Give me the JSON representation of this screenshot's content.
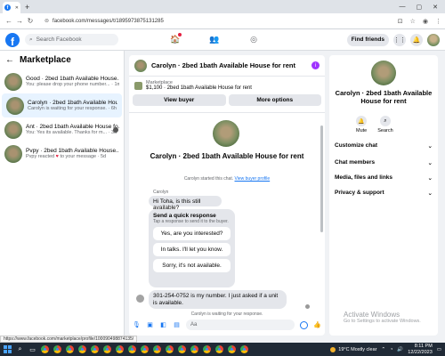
{
  "browser": {
    "tab_favicon": "f",
    "url": "facebook.com/messages/t/1895973875131285",
    "status_url": "https://www.facebook.com/marketplace/profile/100090498874135/"
  },
  "fb": {
    "logo": "f",
    "search_placeholder": "Search Facebook",
    "find_friends": "Find friends"
  },
  "left": {
    "title": "Marketplace",
    "conversations": [
      {
        "name": "Good · 2bed 1bath Available House...",
        "sub": "You: please drop your phone number... · 1m"
      },
      {
        "name": "Carolyn · 2bed 1bath Available House...",
        "sub": "Carolyn is waiting for your response. · 6h"
      },
      {
        "name": "Ant · 2bed 1bath Available House fo...",
        "sub": "You: Yes its available. Thanks for m... · 3d"
      },
      {
        "name": "Pvpy · 2bed 1bath Available House...",
        "sub_prefix": "Pvpy reacted",
        "sub_heart": "♥",
        "sub_suffix": "to your message · 5d"
      }
    ]
  },
  "chat": {
    "header_title": "Carolyn · 2bed 1bath Available House for rent",
    "header_badge": "i",
    "listing_category": "Marketplace",
    "listing_price": "$1,100 · 2bed 1bath Available House for rent",
    "view_buyer": "View buyer",
    "more_options": "More options",
    "big_title": "Carolyn · 2bed 1bath Available House for rent",
    "started_text": "Carolyn started this chat.",
    "started_link": "View buyer profile",
    "sender_name": "Carolyn",
    "msg1": "Hi Toha, is this still available?",
    "quick_title": "Send a quick response",
    "quick_sub": "Tap a response to send it to the buyer.",
    "quick_options": [
      "Yes, are you interested?",
      "In talks. I'll let you know.",
      "Sorry, it's not available."
    ],
    "msg2": "301-254-0752 is my number.  I just asked if a unit is available.",
    "waiting": "Carolyn is waiting for your response.",
    "compose_placeholder": "Aa"
  },
  "right": {
    "title": "Carolyn · 2bed 1bath Available House for rent",
    "mute": "Mute",
    "search": "Search",
    "sections": [
      "Customize chat",
      "Chat members",
      "Media, files and links",
      "Privacy & support"
    ],
    "watermark_title": "Activate Windows",
    "watermark_sub": "Go to Settings to activate Windows."
  },
  "taskbar": {
    "weather": "19°C  Mostly clear",
    "time": "8:11 PM",
    "date": "12/22/2023"
  }
}
